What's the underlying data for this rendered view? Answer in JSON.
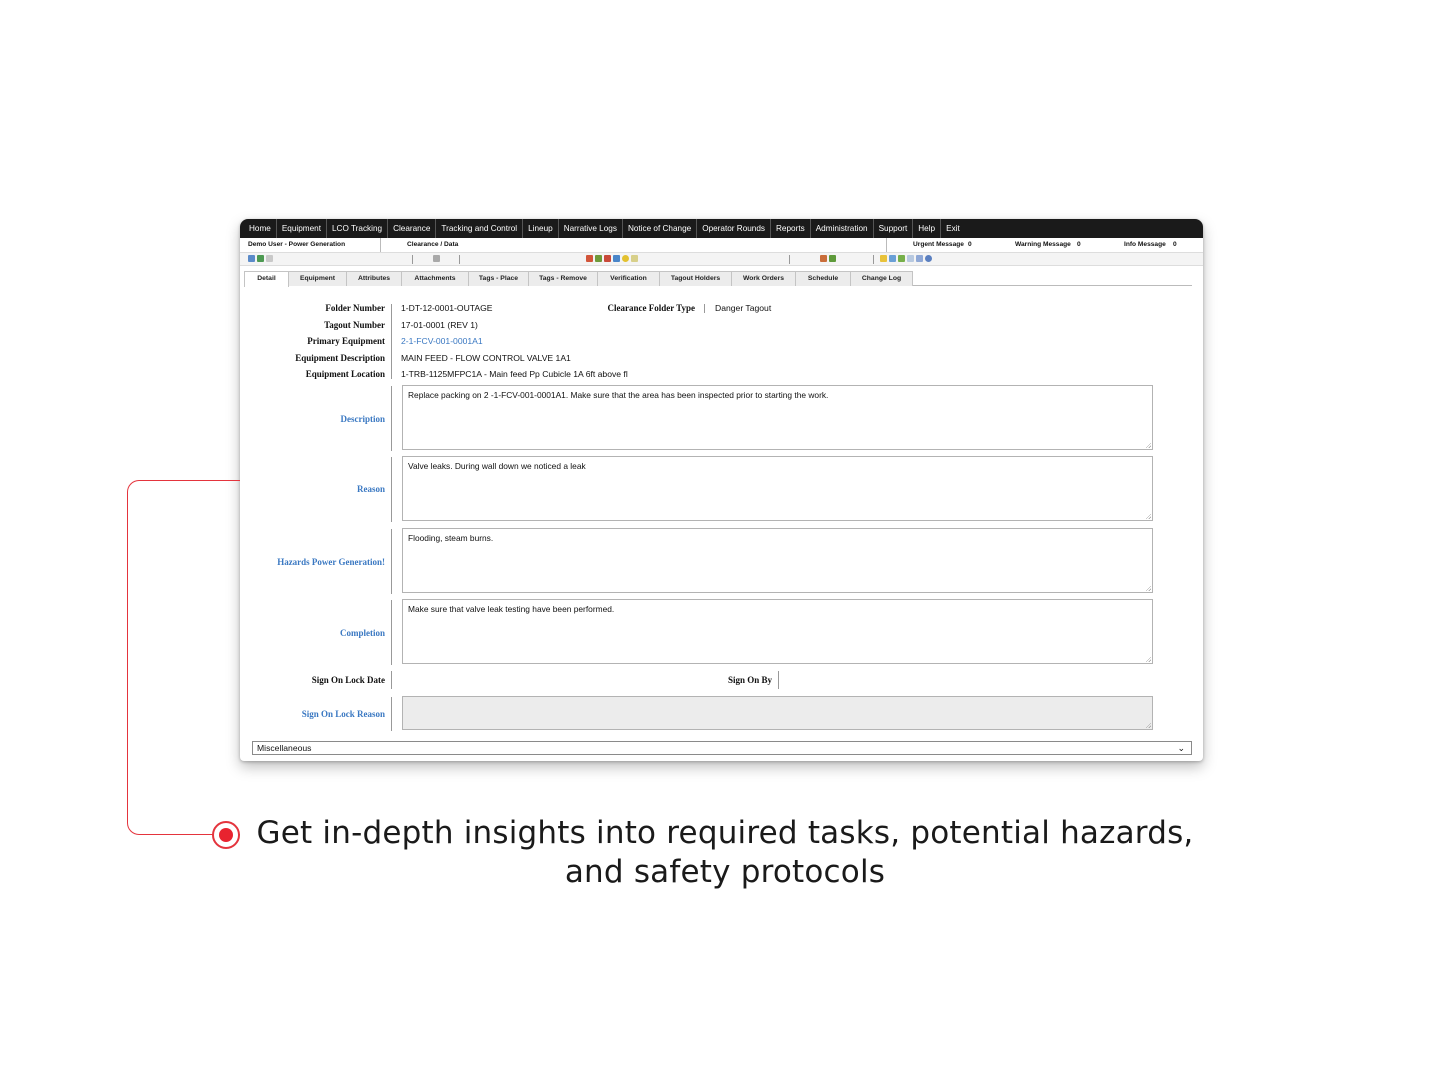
{
  "menu": [
    "Home",
    "Equipment",
    "LCO Tracking",
    "Clearance",
    "Tracking and Control",
    "Lineup",
    "Narrative Logs",
    "Notice of Change",
    "Operator Rounds",
    "Reports",
    "Administration",
    "Support",
    "Help",
    "Exit"
  ],
  "status": {
    "user": "Demo User - Power Generation",
    "breadcrumb": "Clearance / Data",
    "urgent_label": "Urgent Message",
    "urgent_count": "0",
    "warning_label": "Warning Message",
    "warning_count": "0",
    "info_label": "Info Message",
    "info_count": "0"
  },
  "tabs": [
    "Detail",
    "Equipment",
    "Attributes",
    "Attachments",
    "Tags - Place",
    "Tags - Remove",
    "Verification",
    "Tagout Holders",
    "Work Orders",
    "Schedule",
    "Change Log"
  ],
  "active_tab": "Detail",
  "fields": {
    "folder_number_label": "Folder Number",
    "folder_number": "1-DT-12-0001-OUTAGE",
    "folder_type_label": "Clearance Folder Type",
    "folder_type": "Danger Tagout",
    "tagout_number_label": "Tagout Number",
    "tagout_number": "17-01-0001 (REV 1)",
    "primary_equipment_label": "Primary Equipment",
    "primary_equipment": "2-1-FCV-001-0001A1",
    "equipment_description_label": "Equipment Description",
    "equipment_description": "MAIN FEED - FLOW CONTROL VALVE 1A1",
    "equipment_location_label": "Equipment Location",
    "equipment_location": "1-TRB-1125MFPC1A - Main feed Pp Cubicle 1A 6ft above fl",
    "description_label": "Description",
    "description": "Replace packing on 2 -1-FCV-001-0001A1. Make sure that the area has been inspected prior to starting the work.",
    "reason_label": "Reason",
    "reason": "Valve leaks. During wall down we noticed a leak",
    "hazards_label": "Hazards Power Generation!",
    "hazards": "Flooding, steam burns.",
    "completion_label": "Completion",
    "completion": "Make sure that valve leak testing have been performed.",
    "sign_on_lock_date_label": "Sign On Lock Date",
    "sign_on_by_label": "Sign On By",
    "sign_on_lock_reason_label": "Sign On Lock Reason",
    "sign_on_lock_reason": ""
  },
  "miscellaneous": "Miscellaneous",
  "caption": {
    "line1": "Get in-depth insights into required tasks, potential hazards,",
    "line2": "and safety protocols"
  },
  "colors": {
    "accent": "#e4343d",
    "link": "#3a78c2",
    "menubar": "#1a1a1a"
  }
}
